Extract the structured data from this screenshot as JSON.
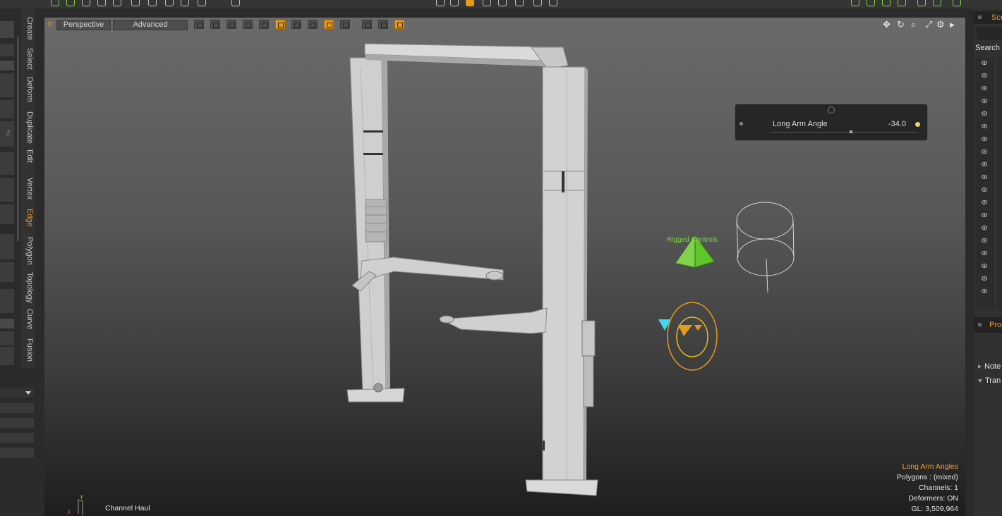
{
  "vertical_tabs": [
    {
      "label": "Create",
      "active": false
    },
    {
      "label": "Select",
      "active": false
    },
    {
      "label": "Deform",
      "active": false
    },
    {
      "label": "Duplicate",
      "active": false
    },
    {
      "label": "Edit",
      "active": false
    },
    {
      "label": "Vertex",
      "active": false
    },
    {
      "label": "Edge",
      "active": true
    },
    {
      "label": "Polygon",
      "active": false
    },
    {
      "label": "Topology",
      "active": false
    },
    {
      "label": "Curve",
      "active": false
    },
    {
      "label": "Fusion",
      "active": false
    }
  ],
  "viewport": {
    "view_mode": "Perspective",
    "shading": "Advanced",
    "channel_popup": {
      "label": "Long Arm Angle",
      "value": "-34.0"
    },
    "rigged_controls_label": "Rigged Controls",
    "bottom_left_label": "Channel Haul",
    "axis_labels": {
      "x": "X",
      "y": "Y"
    },
    "info": {
      "item": "Long Arm Angles",
      "polygons": "Polygons : (mixed)",
      "channels": "Channels: 1",
      "deformers": "Deformers: ON",
      "gl": "GL: 3,509,964"
    }
  },
  "left_panel": {
    "axis_letter": "Z"
  },
  "right_panel": {
    "tab_label": "Sce",
    "search_label": "Search",
    "properties_tab": "Prop",
    "groups": [
      {
        "label": "Note",
        "expanded": false
      },
      {
        "label": "Tran",
        "expanded": true
      }
    ]
  },
  "colors": {
    "accent": "#e8952b",
    "green": "#7fd34a",
    "cyan": "#3fd8f0"
  }
}
